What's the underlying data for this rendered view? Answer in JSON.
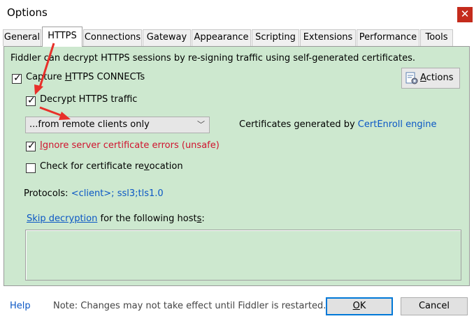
{
  "window": {
    "title": "Options",
    "close_glyph": "✕"
  },
  "tabs": [
    {
      "label": "General"
    },
    {
      "label": "HTTPS",
      "active": true
    },
    {
      "label": "Connections"
    },
    {
      "label": "Gateway"
    },
    {
      "label": "Appearance"
    },
    {
      "label": "Scripting"
    },
    {
      "label": "Extensions"
    },
    {
      "label": "Performance"
    },
    {
      "label": "Tools"
    }
  ],
  "https": {
    "description": "Fiddler can decrypt HTTPS sessions by re-signing traffic using self-generated certificates.",
    "capture_connects": {
      "label_pre": "Capture ",
      "accel": "H",
      "label_post": "TTPS CONNECTs",
      "checked": true
    },
    "decrypt_traffic": {
      "label": "Decrypt HTTPS traffic",
      "checked": true
    },
    "decrypt_source": {
      "selected": "...from remote clients only"
    },
    "cert_info": {
      "prefix": "Certificates generated by ",
      "engine": "CertEnroll engine"
    },
    "ignore_errors": {
      "accel": "I",
      "label": "gnore server certificate errors (unsafe)",
      "checked": true
    },
    "check_revocation": {
      "label_pre": "Check for certificate re",
      "accel": "v",
      "label_post": "ocation",
      "checked": false
    },
    "protocols": {
      "label": "Protocols: ",
      "value": "<client>; ssl3;tls1.0"
    },
    "skip": {
      "link": "Skip decryption",
      "text_pre": " for the following host",
      "accel": "s",
      "text_post": ":"
    },
    "hosts_value": "",
    "actions_button": {
      "accel": "A",
      "label": "ctions",
      "icon": "certificate-gear-icon"
    }
  },
  "footer": {
    "help": "Help",
    "note": "Note: Changes may not take effect until Fiddler is restarted.",
    "ok": {
      "accel": "O",
      "label": "K"
    },
    "cancel": "Cancel"
  },
  "colors": {
    "panel_bg": "#cde8cf",
    "link": "#0b57c5",
    "warning": "#d0132e",
    "annotation_arrow": "#e8302a",
    "close_button": "#c42b1c"
  }
}
